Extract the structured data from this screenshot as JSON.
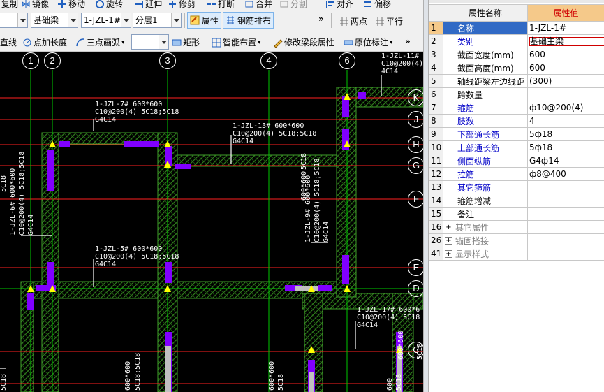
{
  "toolbar_top": {
    "items": [
      "复制",
      "镜像",
      "移动",
      "旋转",
      "延伸",
      "修剪",
      "打断",
      "合并",
      "分割",
      "对齐",
      "偏移"
    ]
  },
  "toolbar_mid": {
    "category_value": "基础梁",
    "member_value": "1-JZL-1#",
    "layer_value": "分层1",
    "property_label": "属性",
    "rebar_layout_label": "钢筋排布",
    "two_point_label": "两点",
    "parallel_label": "平行"
  },
  "toolbar_bottom": {
    "line_label": "直线",
    "point_length_label": "点加长度",
    "three_point_arc_label": "三点画弧",
    "rect_label": "矩形",
    "smart_layout_label": "智能布置",
    "modify_segment_label": "修改梁段属性",
    "origin_mark_label": "原位标注"
  },
  "canvas": {
    "axes_top": [
      "1",
      "2",
      "3",
      "4",
      "6"
    ],
    "axes_right": [
      "K",
      "J",
      "H",
      "G",
      "F",
      "E",
      "D",
      "C"
    ],
    "partial_axis_top": "1",
    "beam_labels": [
      {
        "id": "zl11",
        "lines": [
          "1-JZL-11#",
          "C10@200(4)",
          "4C14"
        ]
      },
      {
        "id": "zl7",
        "lines": [
          "1-JZL-7# 600*600",
          "C10@200(4) 5C18;5C18",
          "G4C14"
        ]
      },
      {
        "id": "zl13",
        "lines": [
          "1-JZL-13# 600*600",
          "C10@200(4) 5C18;5C18",
          "G4C14"
        ]
      },
      {
        "id": "zl5",
        "lines": [
          "1-JZL-5# 600*600",
          "C10@200(4) 5C18;5C18",
          "G4C14"
        ]
      },
      {
        "id": "zl17",
        "lines": [
          "1-JZL-17# 600*6",
          "C10@200(4) 5C18",
          "G4C14"
        ]
      }
    ],
    "vertical_labels": [
      {
        "id": "v1",
        "text": "5C18"
      },
      {
        "id": "v2",
        "text": "1-JZL-6# 600*600"
      },
      {
        "id": "v3",
        "text": "C10@200(4) 5C18;5C18"
      },
      {
        "id": "v4",
        "text": "G4C14"
      },
      {
        "id": "v5",
        "text": "5C18"
      },
      {
        "id": "v6",
        "text": "600*600"
      },
      {
        "id": "v7",
        "text": "1-JZL-9# 600*600"
      },
      {
        "id": "v8",
        "text": "C10@200(4) 5C18;5C18"
      },
      {
        "id": "v9",
        "text": "G4C14"
      },
      {
        "id": "v10",
        "text": "600*600"
      },
      {
        "id": "v11",
        "text": "5C18;5C18"
      },
      {
        "id": "v12",
        "text": "600*600"
      },
      {
        "id": "v13",
        "text": "5C18"
      },
      {
        "id": "v14",
        "text": "600"
      },
      {
        "id": "v15",
        "text": "5C18"
      },
      {
        "id": "v16",
        "text": "600*600"
      },
      {
        "id": "v17",
        "text": "5C18"
      },
      {
        "id": "v18",
        "text": "5C18"
      }
    ]
  },
  "property_panel": {
    "header_name": "属性名称",
    "header_value": "属性值",
    "rows": [
      {
        "no": "1",
        "name": "名称",
        "value": "1-JZL-1#",
        "style": "selected"
      },
      {
        "no": "2",
        "name": "类别",
        "value": "基础主梁",
        "style": "blue"
      },
      {
        "no": "3",
        "name": "截面宽度(mm)",
        "value": "600",
        "style": "black"
      },
      {
        "no": "4",
        "name": "截面高度(mm)",
        "value": "600",
        "style": "black"
      },
      {
        "no": "5",
        "name": "轴线距梁左边线距",
        "value": "(300)",
        "style": "black"
      },
      {
        "no": "6",
        "name": "跨数量",
        "value": "",
        "style": "black"
      },
      {
        "no": "7",
        "name": "箍筋",
        "value": "ф10@200(4)",
        "style": "blue"
      },
      {
        "no": "8",
        "name": "肢数",
        "value": "4",
        "style": "blue"
      },
      {
        "no": "9",
        "name": "下部通长筋",
        "value": "5ф18",
        "style": "blue"
      },
      {
        "no": "10",
        "name": "上部通长筋",
        "value": "5ф18",
        "style": "blue"
      },
      {
        "no": "11",
        "name": "侧面纵筋",
        "value": "G4ф14",
        "style": "blue"
      },
      {
        "no": "12",
        "name": "拉筋",
        "value": "ф8@400",
        "style": "blue"
      },
      {
        "no": "13",
        "name": "其它箍筋",
        "value": "",
        "style": "blue"
      },
      {
        "no": "14",
        "name": "箍筋增减",
        "value": "",
        "style": "black"
      },
      {
        "no": "15",
        "name": "备注",
        "value": "",
        "style": "black"
      },
      {
        "no": "16",
        "name": "其它属性",
        "value": "",
        "style": "group"
      },
      {
        "no": "26",
        "name": "锚固搭接",
        "value": "",
        "style": "group"
      },
      {
        "no": "41",
        "name": "显示样式",
        "value": "",
        "style": "group"
      }
    ]
  },
  "colors": {
    "canvas_bg": "#000000",
    "axis_line": "#ff2020",
    "grid_green": "#00c800",
    "beam_hatch": "#3a7a20",
    "rebar_purple": "#8000ff",
    "node_yellow": "#ffff00",
    "selected_header": "#f5c98a",
    "selected_name": "#316ac5"
  }
}
